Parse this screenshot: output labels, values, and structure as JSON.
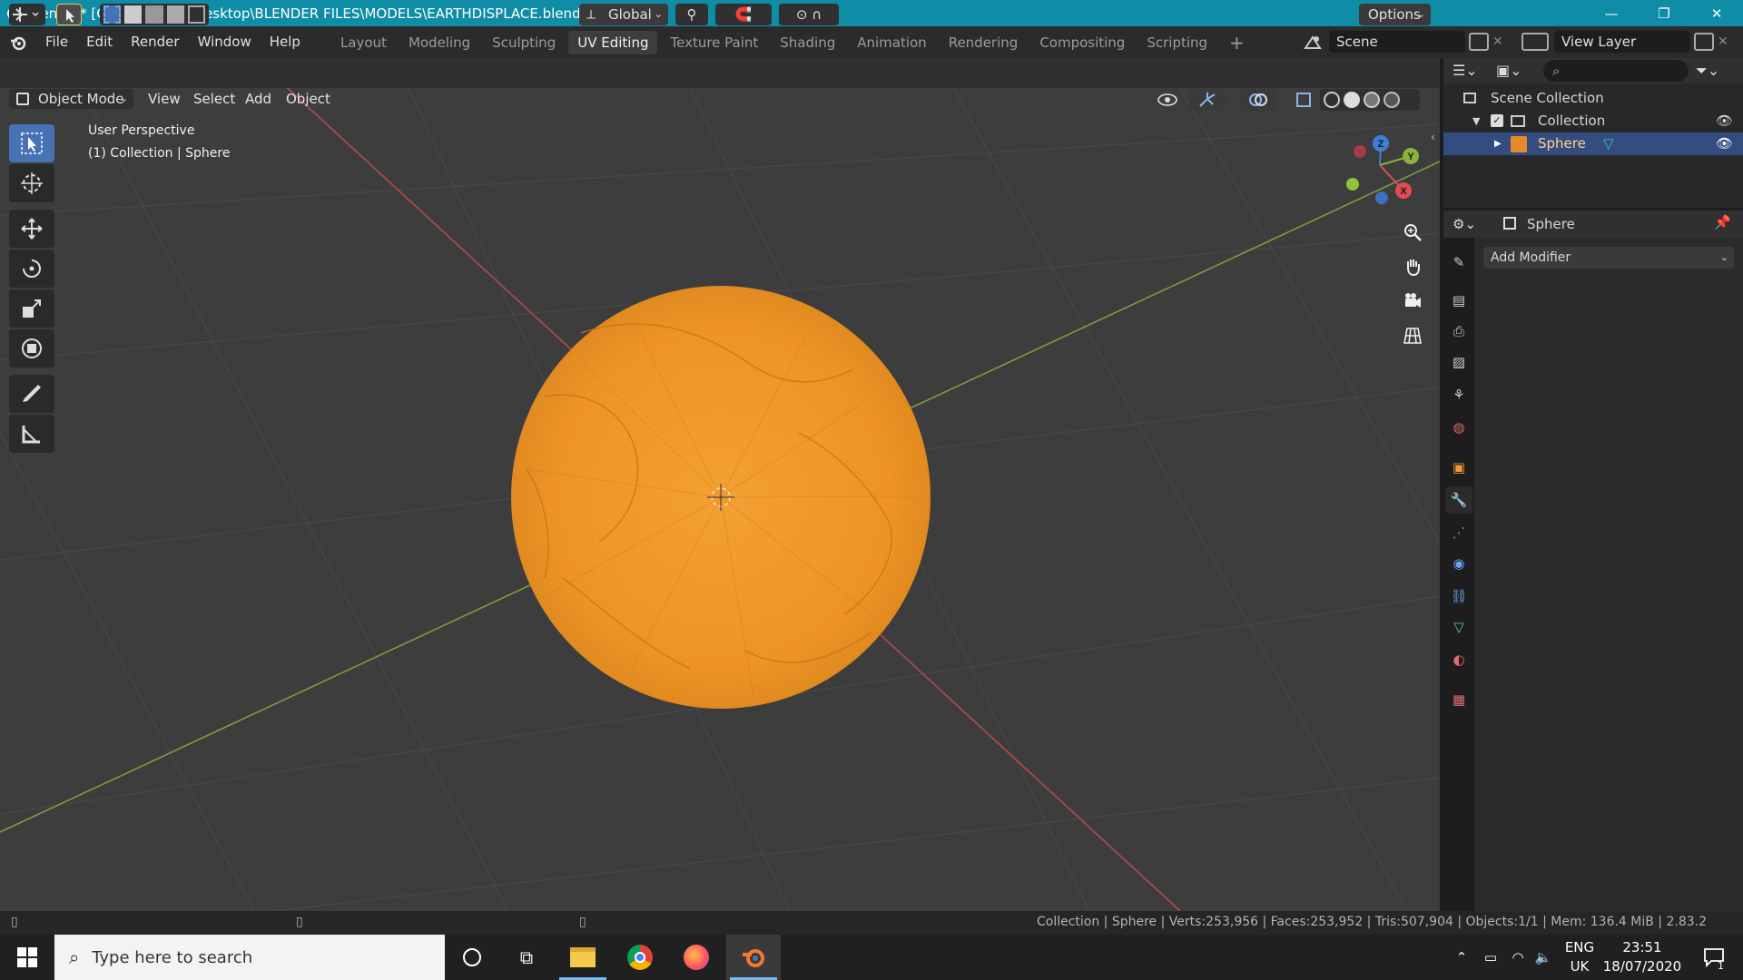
{
  "titlebar": {
    "title": "Blender* [C:\\Users\\virtu\\Desktop\\BLENDER FILES\\MODELS\\EARTHDISPLACE.blend]",
    "minimize": "—",
    "maximize": "❐",
    "close": "✕"
  },
  "menu": {
    "items": [
      "File",
      "Edit",
      "Render",
      "Window",
      "Help"
    ]
  },
  "workspaces": {
    "tabs": [
      "Layout",
      "Modeling",
      "Sculpting",
      "UV Editing",
      "Texture Paint",
      "Shading",
      "Animation",
      "Rendering",
      "Compositing",
      "Scripting"
    ],
    "active": "UV Editing",
    "add": "+"
  },
  "scene": {
    "label": "Scene"
  },
  "view_layer": {
    "label": "View Layer"
  },
  "viewport_header": {
    "transform_orientation": "Global",
    "options": "Options"
  },
  "viewport_menu": {
    "mode": "Object Mode",
    "items": [
      "View",
      "Select",
      "Add",
      "Object"
    ]
  },
  "overlay_text": {
    "perspective": "User Perspective",
    "collection": "(1) Collection | Sphere"
  },
  "gizmo": {
    "z": "Z",
    "y": "Y",
    "x": "X"
  },
  "outliner": {
    "root": "Scene Collection",
    "collection": "Collection",
    "object": "Sphere",
    "search_placeholder": ""
  },
  "properties": {
    "object_name": "Sphere",
    "add_modifier": "Add Modifier"
  },
  "statusbar": {
    "stats": "Collection | Sphere | Verts:253,956 | Faces:253,952 | Tris:507,904 | Objects:1/1 | Mem: 136.4 MiB | 2.83.2"
  },
  "taskbar": {
    "search_placeholder": "Type here to search",
    "lang1": "ENG",
    "lang2": "UK",
    "time": "23:51",
    "date": "18/07/2020",
    "notif_count": "1"
  },
  "colors": {
    "accent": "#4772b3",
    "sphere": "#f39a2c",
    "x_axis": "#c9484f",
    "y_axis": "#7ea53a",
    "titlebar": "#0f8ca6"
  }
}
